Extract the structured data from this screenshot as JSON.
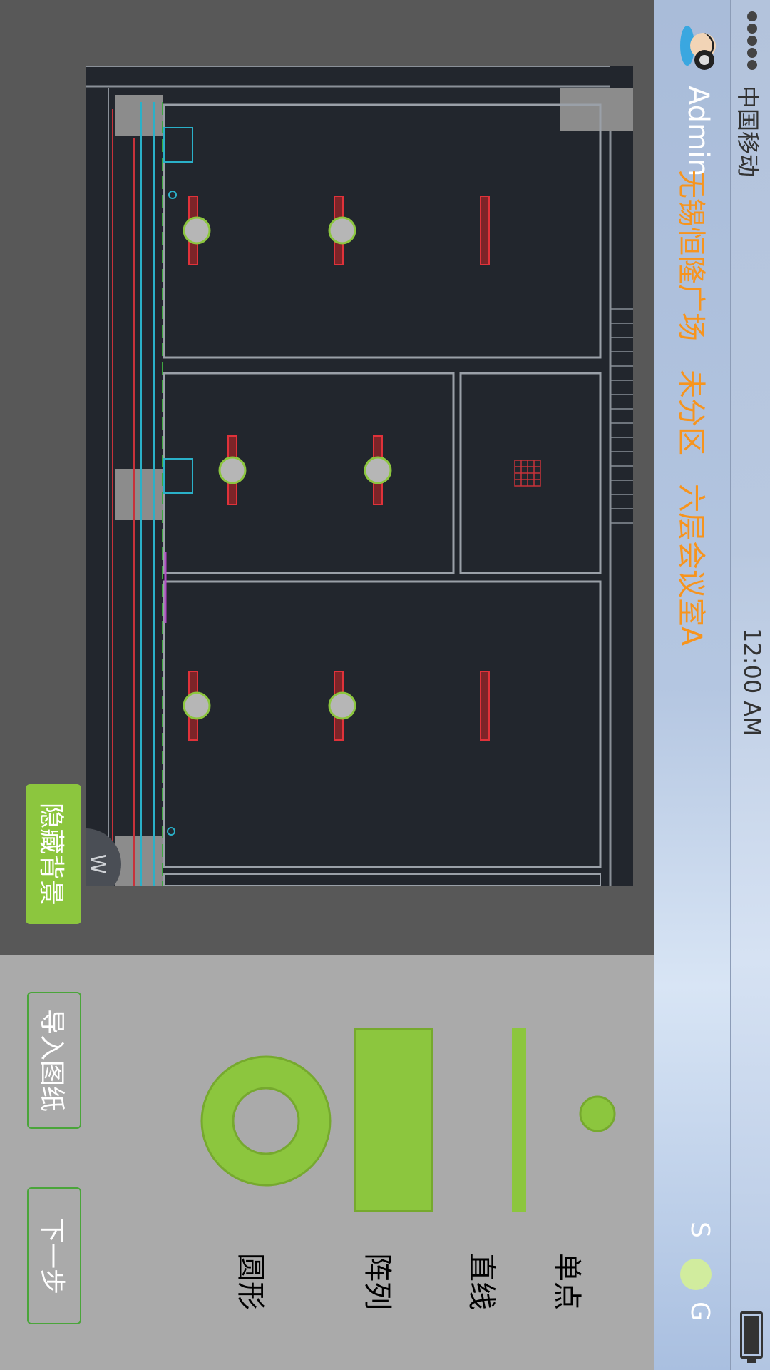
{
  "status_bar": {
    "carrier": "中国移动",
    "time": "12:00 AM"
  },
  "header": {
    "user": "Admin",
    "breadcrumb": [
      "无锡恒隆广场",
      "未分区",
      "六层会议室A"
    ],
    "right_left_label": "S",
    "right_right_label": "G"
  },
  "canvas": {
    "hide_background_label": "隐藏背景",
    "compass_letter": "W"
  },
  "tools": {
    "items": [
      {
        "label": "单点"
      },
      {
        "label": "直线"
      },
      {
        "label": "阵列"
      },
      {
        "label": "圆形"
      }
    ],
    "import_label": "导入图纸",
    "next_label": "下一步"
  },
  "colors": {
    "accent_green": "#8cc63e",
    "breadcrumb_orange": "#f7941d",
    "panel_gray": "#aaaaaa",
    "drawing_bg": "#22262d"
  }
}
